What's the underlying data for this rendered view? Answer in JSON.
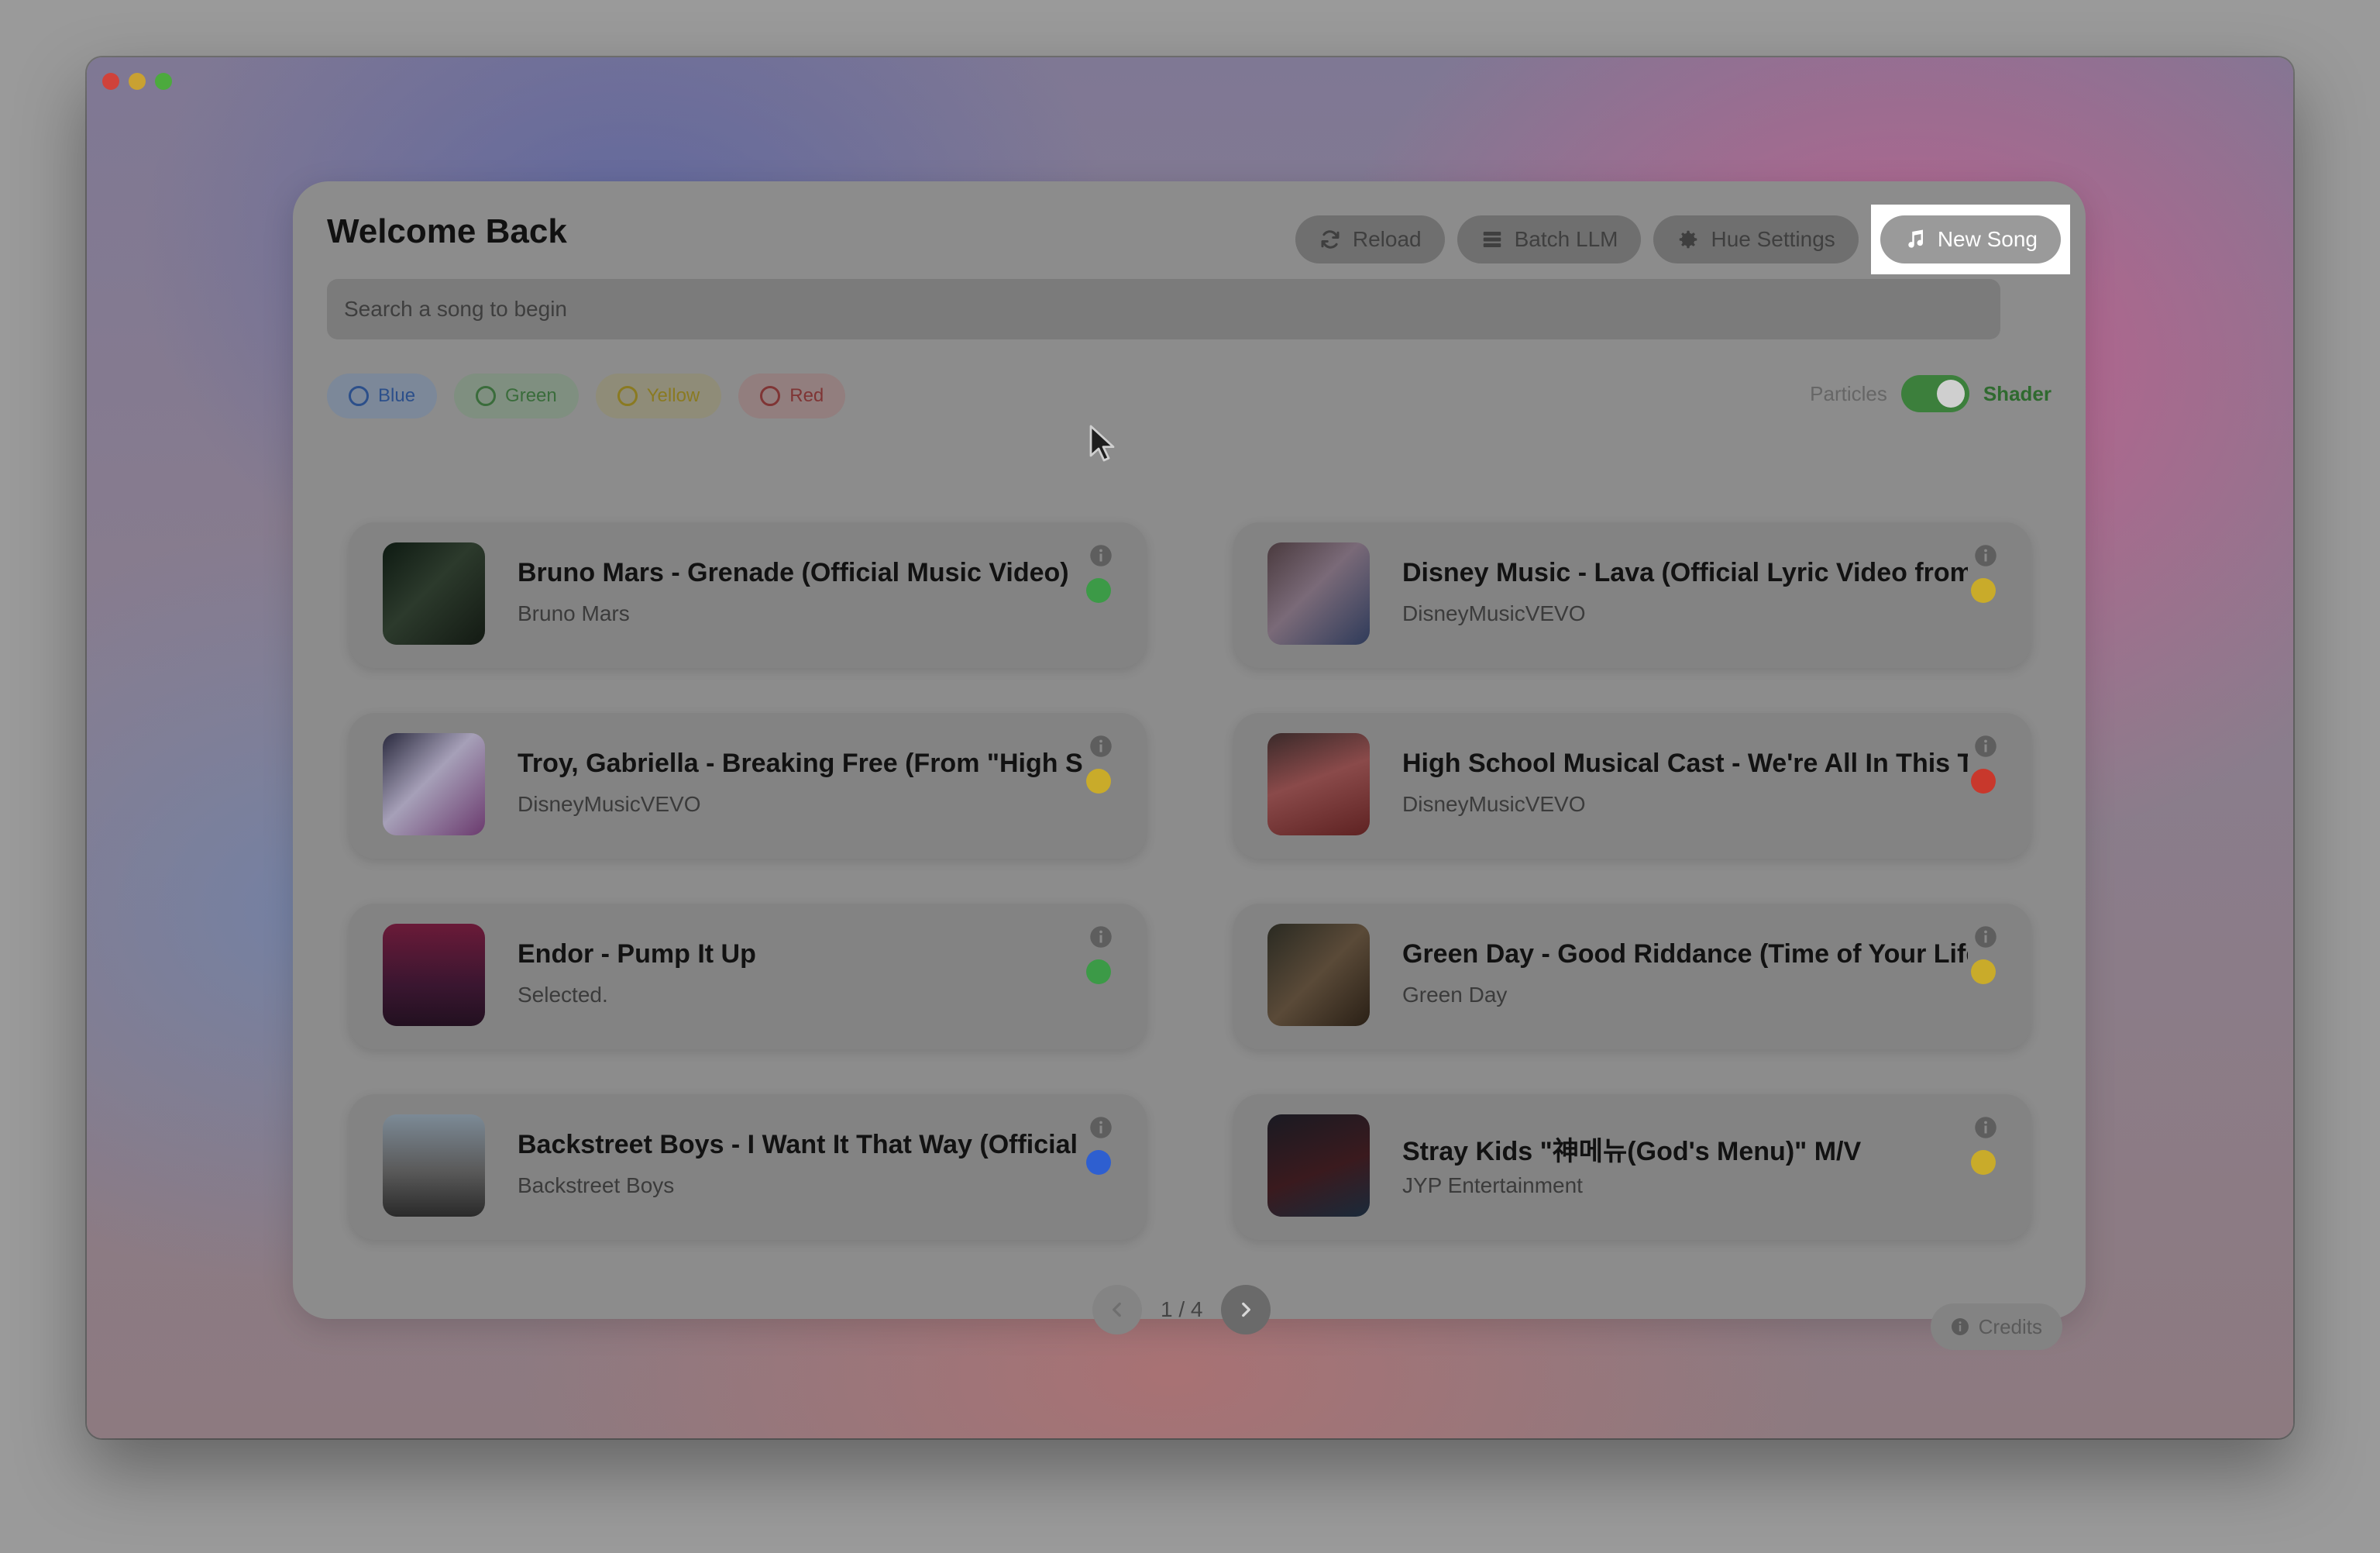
{
  "header": {
    "title": "Welcome Back",
    "toolbar": {
      "reload": "Reload",
      "batch_llm": "Batch LLM",
      "hue_settings": "Hue Settings",
      "new_song": "New Song"
    }
  },
  "search": {
    "placeholder": "Search a song to begin",
    "value": ""
  },
  "filters": {
    "blue": "Blue",
    "green": "Green",
    "yellow": "Yellow",
    "red": "Red"
  },
  "mode": {
    "left_label": "Particles",
    "right_label": "Shader",
    "shader_enabled": true
  },
  "colors": {
    "green": "#3c9a47",
    "yellow": "#c9ab2a",
    "red": "#c8382c",
    "blue": "#2e5fd0"
  },
  "songs": [
    {
      "title": "Bruno Mars - Grenade (Official Music Video)",
      "artist": "Bruno Mars",
      "color": "green",
      "icon": "info-icon"
    },
    {
      "title": "Disney Music - Lava (Official Lyric Video from \"Lava\")",
      "artist": "DisneyMusicVEVO",
      "color": "yellow",
      "icon": "info-icon"
    },
    {
      "title": "Troy, Gabriella - Breaking Free (From \"High School Musical\")",
      "artist": "DisneyMusicVEVO",
      "color": "yellow",
      "icon": "info-icon"
    },
    {
      "title": "High School Musical Cast - We're All In This Together",
      "artist": "DisneyMusicVEVO",
      "color": "red",
      "icon": "info-icon"
    },
    {
      "title": "Endor - Pump It Up",
      "artist": "Selected.",
      "color": "green",
      "icon": "info-icon"
    },
    {
      "title": "Green Day - Good Riddance (Time of Your Life)",
      "artist": "Green Day",
      "color": "yellow",
      "icon": "info-icon"
    },
    {
      "title": "Backstreet Boys - I Want It That Way (Official Music Video)",
      "artist": "Backstreet Boys",
      "color": "blue",
      "icon": "info-icon"
    },
    {
      "title": "Stray Kids \"神메뉴(God's Menu)\" M/V",
      "artist": "JYP Entertainment",
      "color": "yellow",
      "icon": "info-icon"
    }
  ],
  "pagination": {
    "text": "1 / 4"
  },
  "footer": {
    "credits": "Credits"
  }
}
